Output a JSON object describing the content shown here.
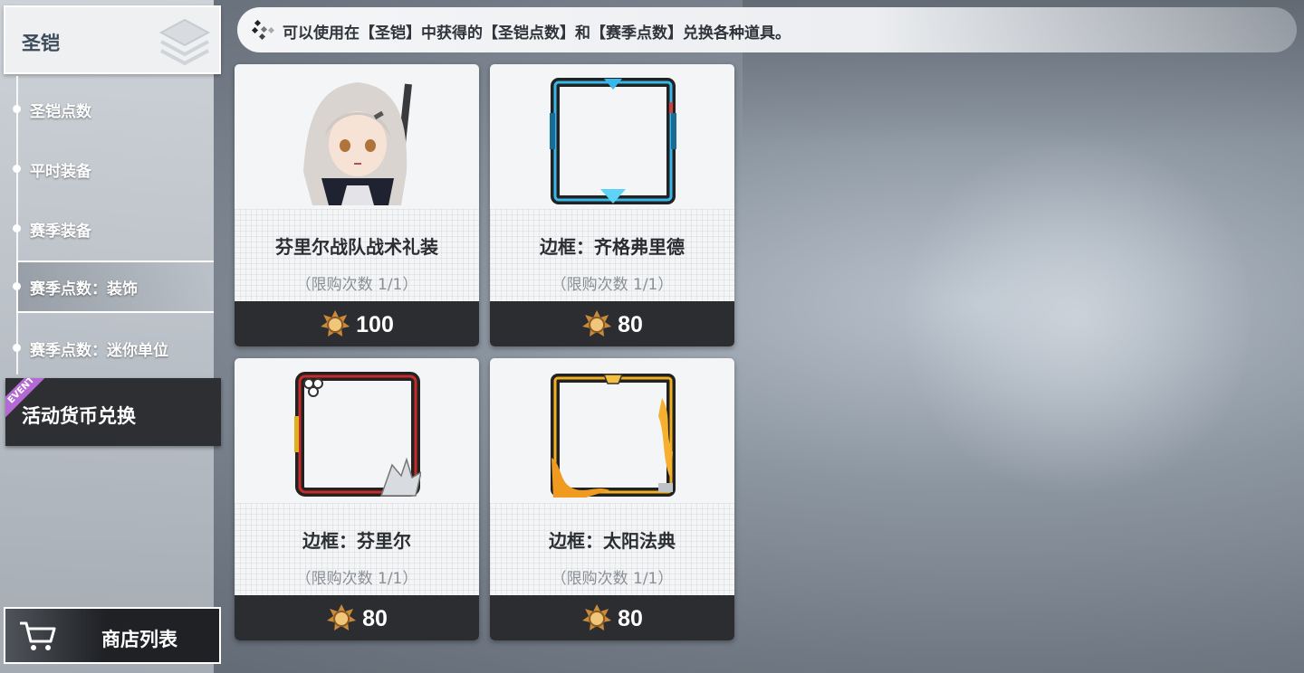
{
  "sidebar": {
    "category_title": "圣铠",
    "items": [
      {
        "label": "圣铠点数",
        "active": false
      },
      {
        "label": "平时装备",
        "active": false
      },
      {
        "label": "赛季装备",
        "active": false
      },
      {
        "label": "赛季点数：装饰",
        "active": true
      },
      {
        "label": "赛季点数：迷你单位",
        "active": false
      }
    ],
    "event_button": {
      "label": "活动货币兑换",
      "badge": "EVENT"
    },
    "shop_button": {
      "label": "商店列表"
    }
  },
  "notice": {
    "text": "可以使用在【圣铠】中获得的【圣铠点数】和【赛季点数】兑换各种道具。"
  },
  "items": [
    {
      "name": "芬里尔战队战术礼装",
      "limit": "（限购次数  1/1）",
      "price": "100",
      "icon": "character-portrait"
    },
    {
      "name": "边框：齐格弗里德",
      "limit": "（限购次数  1/1）",
      "price": "80",
      "icon": "blue-frame"
    },
    {
      "name": "边框：芬里尔",
      "limit": "（限购次数  1/1）",
      "price": "80",
      "icon": "red-frame"
    },
    {
      "name": "边框：太阳法典",
      "limit": "（限购次数  1/1）",
      "price": "80",
      "icon": "gold-frame"
    }
  ],
  "colors": {
    "accent_active": "#ffffff",
    "price_bar": "#2c2d31",
    "event_ribbon": "#b36ad4"
  }
}
